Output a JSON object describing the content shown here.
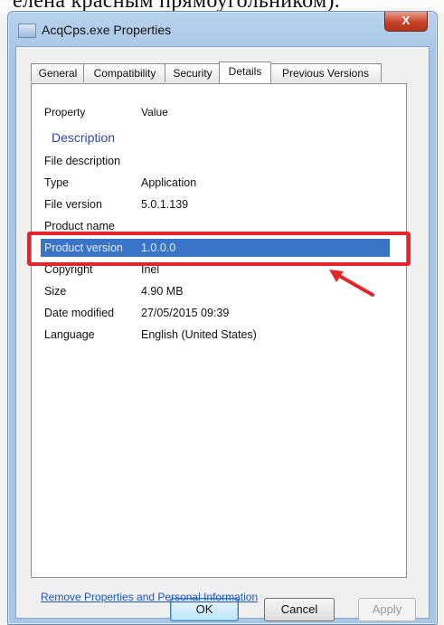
{
  "caption_fragment": "елена красным прямоугольником).",
  "window": {
    "title": "AcqCps.exe Properties",
    "close_glyph": "X"
  },
  "tabs": [
    {
      "label": "General"
    },
    {
      "label": "Compatibility"
    },
    {
      "label": "Security"
    },
    {
      "label": "Details",
      "active": true
    },
    {
      "label": "Previous Versions"
    }
  ],
  "details": {
    "col_property": "Property",
    "col_value": "Value",
    "group": "Description",
    "rows": [
      {
        "property": "File description",
        "value": ""
      },
      {
        "property": "Type",
        "value": "Application"
      },
      {
        "property": "File version",
        "value": "5.0.1.139"
      },
      {
        "property": "Product name",
        "value": ""
      },
      {
        "property": "Product version",
        "value": "1.0.0.0",
        "selected": true
      },
      {
        "property": "Copyright",
        "value": "Inel"
      },
      {
        "property": "Size",
        "value": "4.90 MB"
      },
      {
        "property": "Date modified",
        "value": "27/05/2015 09:39"
      },
      {
        "property": "Language",
        "value": "English (United States)"
      }
    ],
    "remove_link": "Remove Properties and Personal Information"
  },
  "buttons": {
    "ok": "OK",
    "cancel": "Cancel",
    "apply": "Apply"
  },
  "colors": {
    "highlight": "#e3262b",
    "selection": "#3875c8"
  }
}
